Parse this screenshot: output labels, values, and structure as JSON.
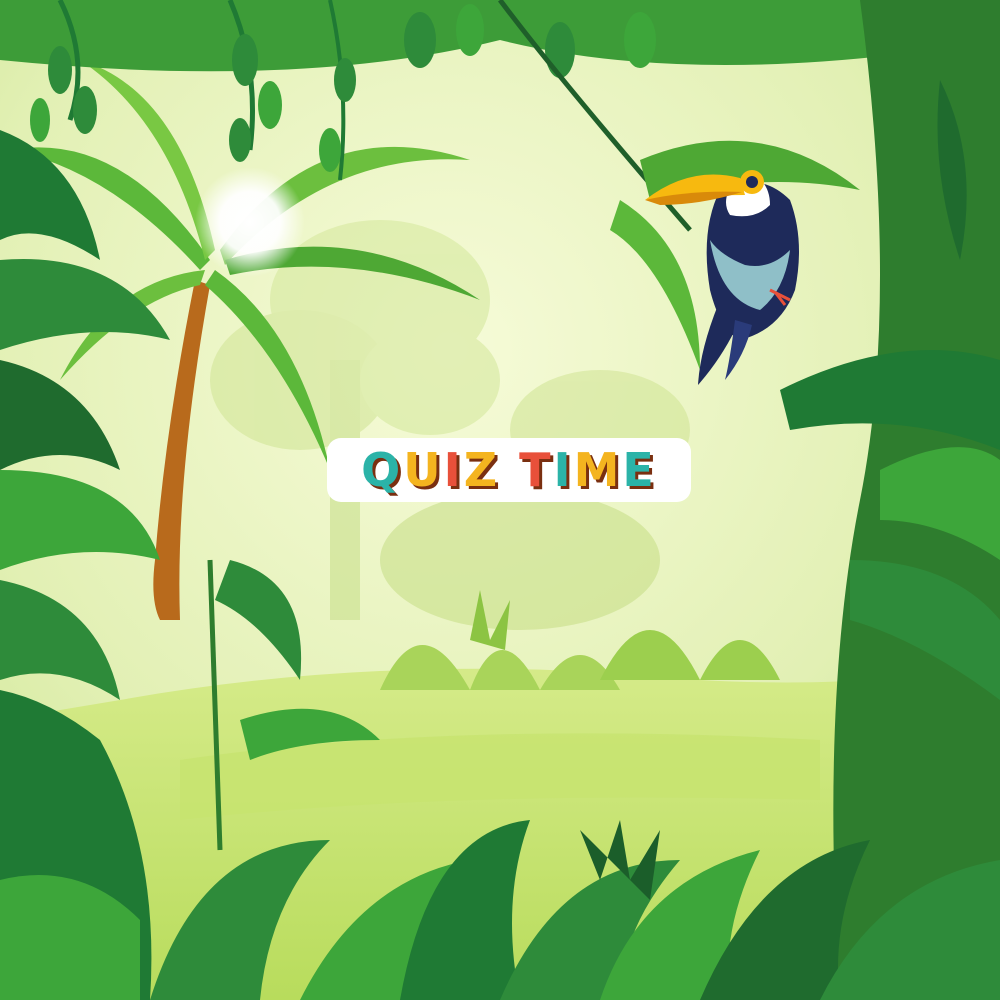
{
  "title": {
    "text": "QUIZ TIME",
    "letter_colors": [
      "#2bb3a8",
      "#f4b41f",
      "#e8503a",
      "#f4b41f",
      "",
      "#e8503a",
      "#2bb3a8",
      "#f4b41f",
      "#2bb3a8"
    ]
  },
  "scene": {
    "background": "jungle",
    "bird": "toucan-icon",
    "sun": "sun-glow-icon",
    "colors": {
      "sky": "#f2f8d0",
      "leaf_dark": "#1f7a34",
      "leaf_mid": "#3da63a",
      "leaf_light": "#8fd14a",
      "trunk": "#b86a1c",
      "beak": "#f7b90f"
    }
  }
}
